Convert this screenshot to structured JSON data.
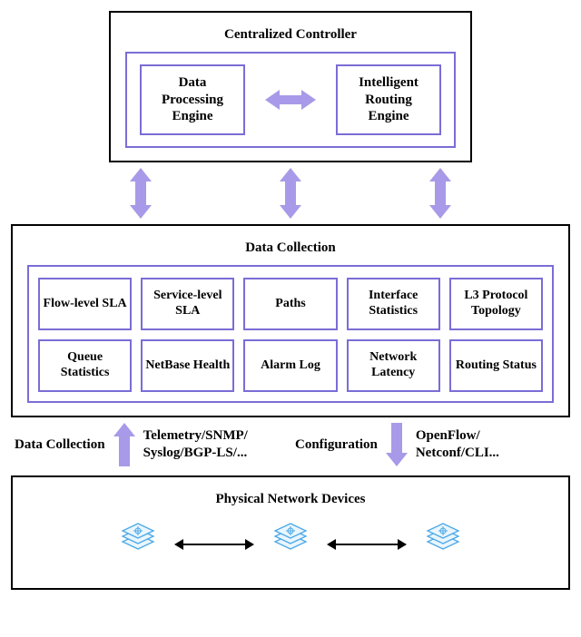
{
  "controller": {
    "title": "Centralized Controller",
    "engines": {
      "dpe": "Data\nProcessing\nEngine",
      "ire": "Intelligent\nRouting\nEngine"
    }
  },
  "data_collection": {
    "title": "Data Collection",
    "items": [
      "Flow-level SLA",
      "Service-level SLA",
      "Paths",
      "Interface Statistics",
      "L3 Protocol Topology",
      "Queue Statistics",
      "NetBase Health",
      "Alarm Log",
      "Network Latency",
      "Routing Status"
    ]
  },
  "protocols": {
    "up_label": "Data Collection",
    "up_tech": "Telemetry/SNMP/\nSyslog/BGP-LS/...",
    "down_label": "Configuration",
    "down_tech": "OpenFlow/\nNetconf/CLI..."
  },
  "devices": {
    "title": "Physical Network Devices"
  }
}
